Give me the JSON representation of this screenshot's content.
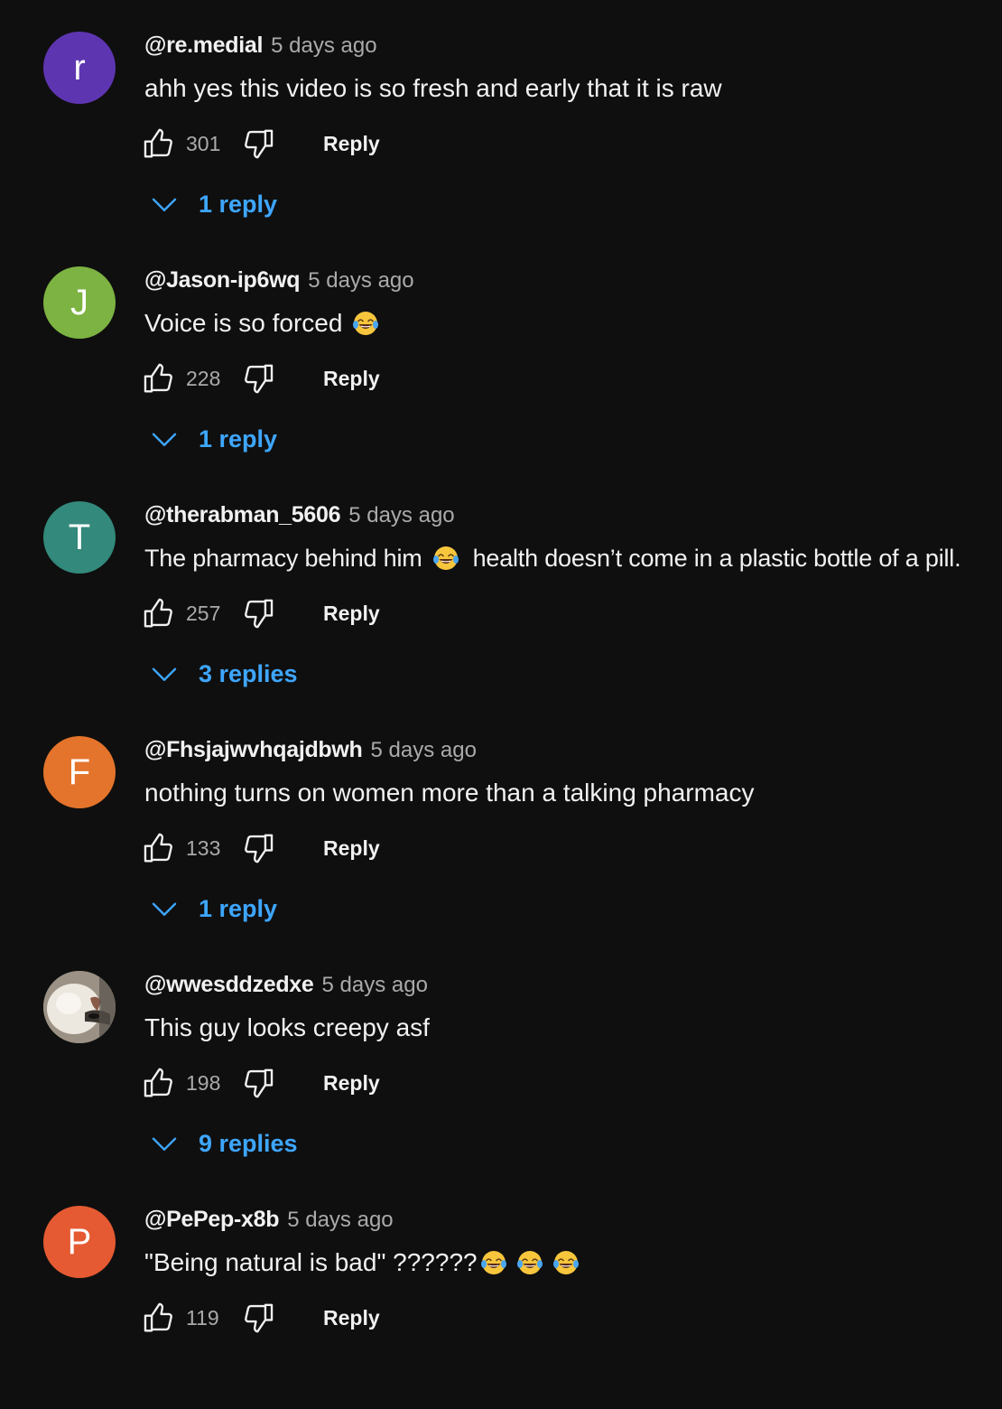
{
  "comments": [
    {
      "author": "@re.medial",
      "time": "5 days ago",
      "avatar_letter": "r",
      "avatar_color": "#5e35b1",
      "text": "ahh yes this video is so fresh and early that it is raw",
      "likes": "301",
      "reply_label": "Reply",
      "replies_label": "1 reply"
    },
    {
      "author": "@Jason-ip6wq",
      "time": "5 days ago",
      "avatar_letter": "J",
      "avatar_color": "#7cb342",
      "text": "Voice is so forced",
      "emojis_after": "😂",
      "likes": "228",
      "reply_label": "Reply",
      "replies_label": "1 reply"
    },
    {
      "author": "@therabman_5606",
      "time": "5 days ago",
      "avatar_letter": "T",
      "avatar_color": "#33897b",
      "text_part1": "The pharmacy behind him",
      "emoji_mid": "😂",
      "text_part2": "health doesn’t come in a plastic bottle of a pill.",
      "likes": "257",
      "reply_label": "Reply",
      "replies_label": "3 replies"
    },
    {
      "author": "@Fhsjajwvhqajdbwh",
      "time": "5 days ago",
      "avatar_letter": "F",
      "avatar_color": "#e4742b",
      "text": "nothing turns on women more than a talking pharmacy",
      "likes": "133",
      "reply_label": "Reply",
      "replies_label": "1 reply"
    },
    {
      "author": "@wwesddzedxe",
      "time": "5 days ago",
      "avatar_type": "photo",
      "text": "This guy looks creepy asf",
      "likes": "198",
      "reply_label": "Reply",
      "replies_label": "9 replies"
    },
    {
      "author": "@PePep-x8b",
      "time": "5 days ago",
      "avatar_letter": "P",
      "avatar_color": "#e55a32",
      "text": "\"Being natural is bad\" ??????",
      "emojis_after": "😂😂😂",
      "likes": "119",
      "reply_label": "Reply"
    }
  ],
  "icons": {
    "like": "thumb-up-outline",
    "dislike": "thumb-down-outline",
    "expand": "chevron-down",
    "emoji": "face-with-tears-of-joy"
  },
  "colors": {
    "background": "#0f0f0f",
    "primary_text": "#f1f1f1",
    "secondary_text": "#aaaaaa",
    "link_blue": "#3ea6ff"
  }
}
